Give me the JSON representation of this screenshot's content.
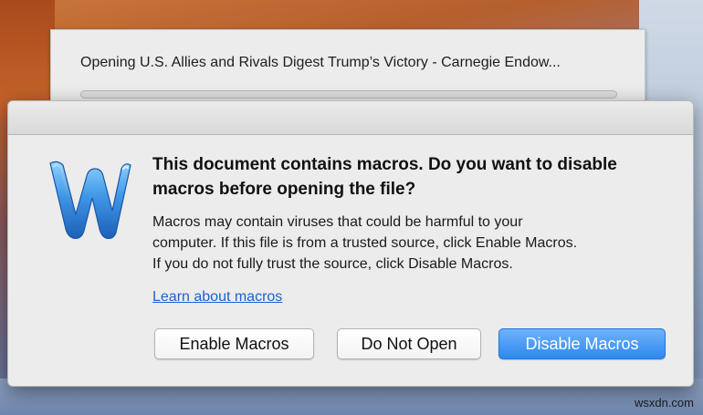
{
  "progress_window": {
    "title": "Opening U.S. Allies and Rivals Digest Trump’s Victory - Carnegie Endow...",
    "progress": 0
  },
  "dialog": {
    "icon": "word-icon",
    "heading": "This document contains macros. Do you want to disable macros before opening the file?",
    "body_line1": "Macros may contain viruses that could be harmful to your",
    "body_line2": "computer.  If this file is from a trusted source, click Enable Macros.",
    "body_line3": "If you do not fully trust the source, click Disable Macros.",
    "link": "Learn about macros",
    "buttons": {
      "enable": "Enable Macros",
      "do_not_open": "Do Not Open",
      "disable": "Disable Macros"
    }
  },
  "watermark": "wsxdn.com",
  "colors": {
    "link": "#1f5fd1",
    "default_button": "#2f88ee",
    "word_blue": "#2d7fd6"
  }
}
